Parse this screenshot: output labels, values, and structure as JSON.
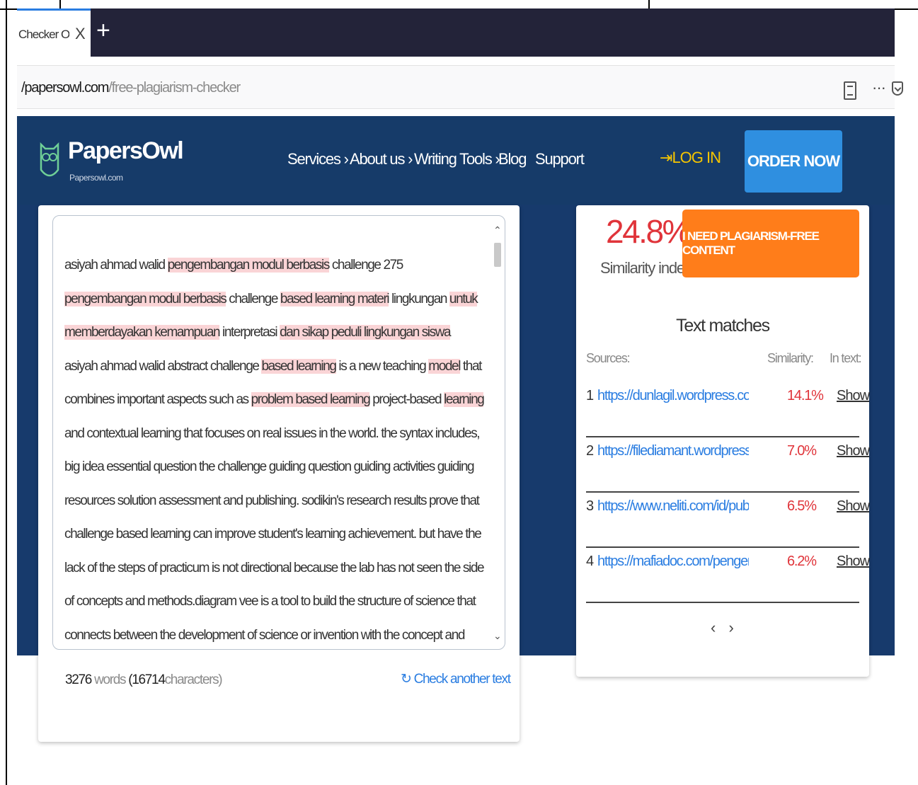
{
  "browser": {
    "tab_title": "Checker Onlin",
    "tab_close": "X",
    "new_tab": "+",
    "url_host": "/papersowl.com",
    "url_path": "/free-plagiarism-checker",
    "more": "···"
  },
  "header": {
    "logo": "PapersOwl",
    "logo_sub": "Papersowl.com",
    "nav": [
      "Services ›",
      "About us ›",
      "Writing Tools ›",
      "Blog",
      "Support"
    ],
    "login": "LOG IN",
    "order": "ORDER NOW",
    "colors": {
      "bar": "#163b69",
      "order": "#2f8fe0",
      "login": "#f5c500"
    }
  },
  "checker": {
    "text_segments": [
      {
        "t": "asiyah ahmad walid ",
        "hl": false
      },
      {
        "t": "pengembangan modul berbasis",
        "hl": true
      },
      {
        "t": " challenge 275 ",
        "hl": false
      },
      {
        "t": "pengembangan modul berbasis",
        "hl": true
      },
      {
        "t": " challenge ",
        "hl": false
      },
      {
        "t": "based learning materi",
        "hl": true
      },
      {
        "t": " lingkungan ",
        "hl": false
      },
      {
        "t": "untuk memberdayakan kemampuan",
        "hl": true
      },
      {
        "t": " interpretasi ",
        "hl": false
      },
      {
        "t": "dan sikap peduli lingkungan siswa",
        "hl": true
      },
      {
        "t": " asiyah ahmad walid abstract challenge ",
        "hl": false
      },
      {
        "t": "based learning",
        "hl": true
      },
      {
        "t": " is a new teaching ",
        "hl": false
      },
      {
        "t": "model",
        "hl": true
      },
      {
        "t": " that combines important aspects such as ",
        "hl": false
      },
      {
        "t": "problem based learning",
        "hl": true
      },
      {
        "t": " project-based ",
        "hl": false
      },
      {
        "t": "learning",
        "hl": true
      },
      {
        "t": " and contextual learning that focuses on real issues in the world. the syntax includes, big idea essential question the challenge guiding question guiding activities guiding resources solution assessment and publishing. sodikin's research results prove that challenge based learning can improve student's learning achievement. but have the lack of the steps of practicum is not directional because the lab has not seen the side of concepts and methods.diagram vee is a tool to build the structure of science that connects between the development of science or invention with the concept and ideas of the theory leads to the question and has a side conceptual and methodological side. both sides actively interact with each other during the use of focus or research questions. lu'luin nur hasanah's research results",
        "hl": false
      }
    ],
    "word_count": "3276",
    "words_label": "words",
    "char_count": "(16714",
    "chars_label": "characters)",
    "check_another": "Check another text",
    "highlight_color": "#fad4d6"
  },
  "results": {
    "similarity": "24.8%",
    "similarity_label": "Similarity index",
    "cta": "I NEED PLAGIARISM-FREE CONTENT",
    "matches_title": "Text matches",
    "col_sources": "Sources:",
    "col_similarity": "Similarity:",
    "col_in_text": "In text:",
    "rows": [
      {
        "n": "1",
        "url": "https://dunlagil.wordpress.com/2...",
        "sim": "14.1%",
        "action": "Show"
      },
      {
        "n": "2",
        "url": "https://filediamant.wordpress.co...",
        "sim": "7.0%",
        "action": "Show"
      },
      {
        "n": "3",
        "url": "https://www.neliti.com/id/publica...",
        "sim": "6.5%",
        "action": "Show"
      },
      {
        "n": "4",
        "url": "https://mafiadoc.com/pengemba...",
        "sim": "6.2%",
        "action": "Show"
      }
    ],
    "pager_prev": "‹",
    "pager_next": "›",
    "colors": {
      "percent": "#e0343a",
      "cta": "#ff7d1a",
      "link": "#2a7de1"
    }
  }
}
